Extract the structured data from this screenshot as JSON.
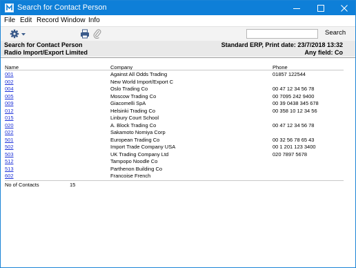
{
  "window": {
    "title": "Search for Contact Person",
    "app_icon": "hansa-app-icon",
    "title_bar_color": "#0e7fd8"
  },
  "menu": [
    "File",
    "Edit",
    "Record",
    "Window",
    "Info"
  ],
  "toolbar": {
    "operations_icon": "gear-icon",
    "print_icon": "printer-icon",
    "attach_icon": "paperclip-icon",
    "search_value": "",
    "search_placeholder": "",
    "search_label": "Search"
  },
  "report": {
    "title": "Search for Contact Person",
    "company": "Radio Import/Export Limited",
    "print_info": "Standard ERP, Print date: 23/7/2018 13:32",
    "filter": "Any field: Co"
  },
  "table": {
    "columns": [
      "Name",
      "Company",
      "Phone"
    ],
    "rows": [
      {
        "code": "001",
        "company": "Against All Odds Trading",
        "phone": "01857 122544"
      },
      {
        "code": "002",
        "company": "New World Import/Export C",
        "phone": ""
      },
      {
        "code": "004",
        "company": "Oslo Trading Co",
        "phone": "00 47 12 34 56 78"
      },
      {
        "code": "005",
        "company": "Moscow Trading Co",
        "phone": "00 7095 242 9400"
      },
      {
        "code": "009",
        "company": "Giacomelli SpA",
        "phone": "00 39 0438 345 678"
      },
      {
        "code": "012",
        "company": "Helsinki Trading Co",
        "phone": "00 358 10 12 34 56"
      },
      {
        "code": "015",
        "company": "Linbury Court School",
        "phone": ""
      },
      {
        "code": "020",
        "company": "A. Block Trading Co",
        "phone": "00 47 12 34 56 78"
      },
      {
        "code": "022",
        "company": "Sakamoto Nomiya Corp",
        "phone": ""
      },
      {
        "code": "501",
        "company": "European Trading Co",
        "phone": "00 32 56 78 65 43"
      },
      {
        "code": "502",
        "company": "Import Trade Company USA",
        "phone": "00 1 201 123 3400"
      },
      {
        "code": "503",
        "company": "UK Trading Company Ltd",
        "phone": "020 7897 5678"
      },
      {
        "code": "512",
        "company": "Tampopo Noodle Co",
        "phone": ""
      },
      {
        "code": "513",
        "company": "Parthenon Building Co",
        "phone": ""
      },
      {
        "code": "602",
        "company": "Francoise French",
        "phone": ""
      }
    ]
  },
  "footer": {
    "label": "No of Contacts",
    "count": "15"
  },
  "colors": {
    "link": "#1a2fd8",
    "header_band": "#e9e9e9"
  }
}
